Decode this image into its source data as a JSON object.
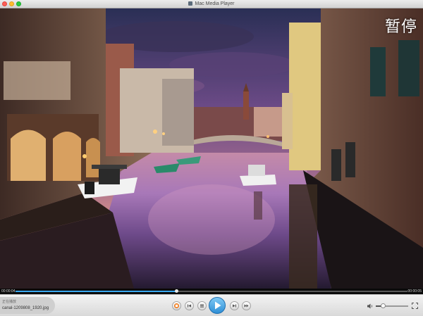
{
  "window": {
    "title": "Mac Media Player"
  },
  "overlay": {
    "status_text": "暂停"
  },
  "progress": {
    "current_time": "00:00:04",
    "total_time": "00:00:05",
    "played_fraction": 0.41
  },
  "now_playing": {
    "label": "正在播放",
    "file_name": "canal-1209808_1920.jpg"
  },
  "controls": {
    "buttons": [
      {
        "name": "stop-button",
        "icon": "stop-icon"
      },
      {
        "name": "previous-button",
        "icon": "previous-icon"
      },
      {
        "name": "menu-button",
        "icon": "list-icon"
      },
      {
        "name": "play-button",
        "icon": "play-icon"
      },
      {
        "name": "next-button",
        "icon": "next-icon"
      },
      {
        "name": "skip-forward-button",
        "icon": "skip-forward-icon"
      }
    ],
    "volume_fraction": 0.22
  },
  "colors": {
    "accent": "#3aa8f0",
    "stop": "#f07a1a",
    "titlebar": "#dedede"
  }
}
